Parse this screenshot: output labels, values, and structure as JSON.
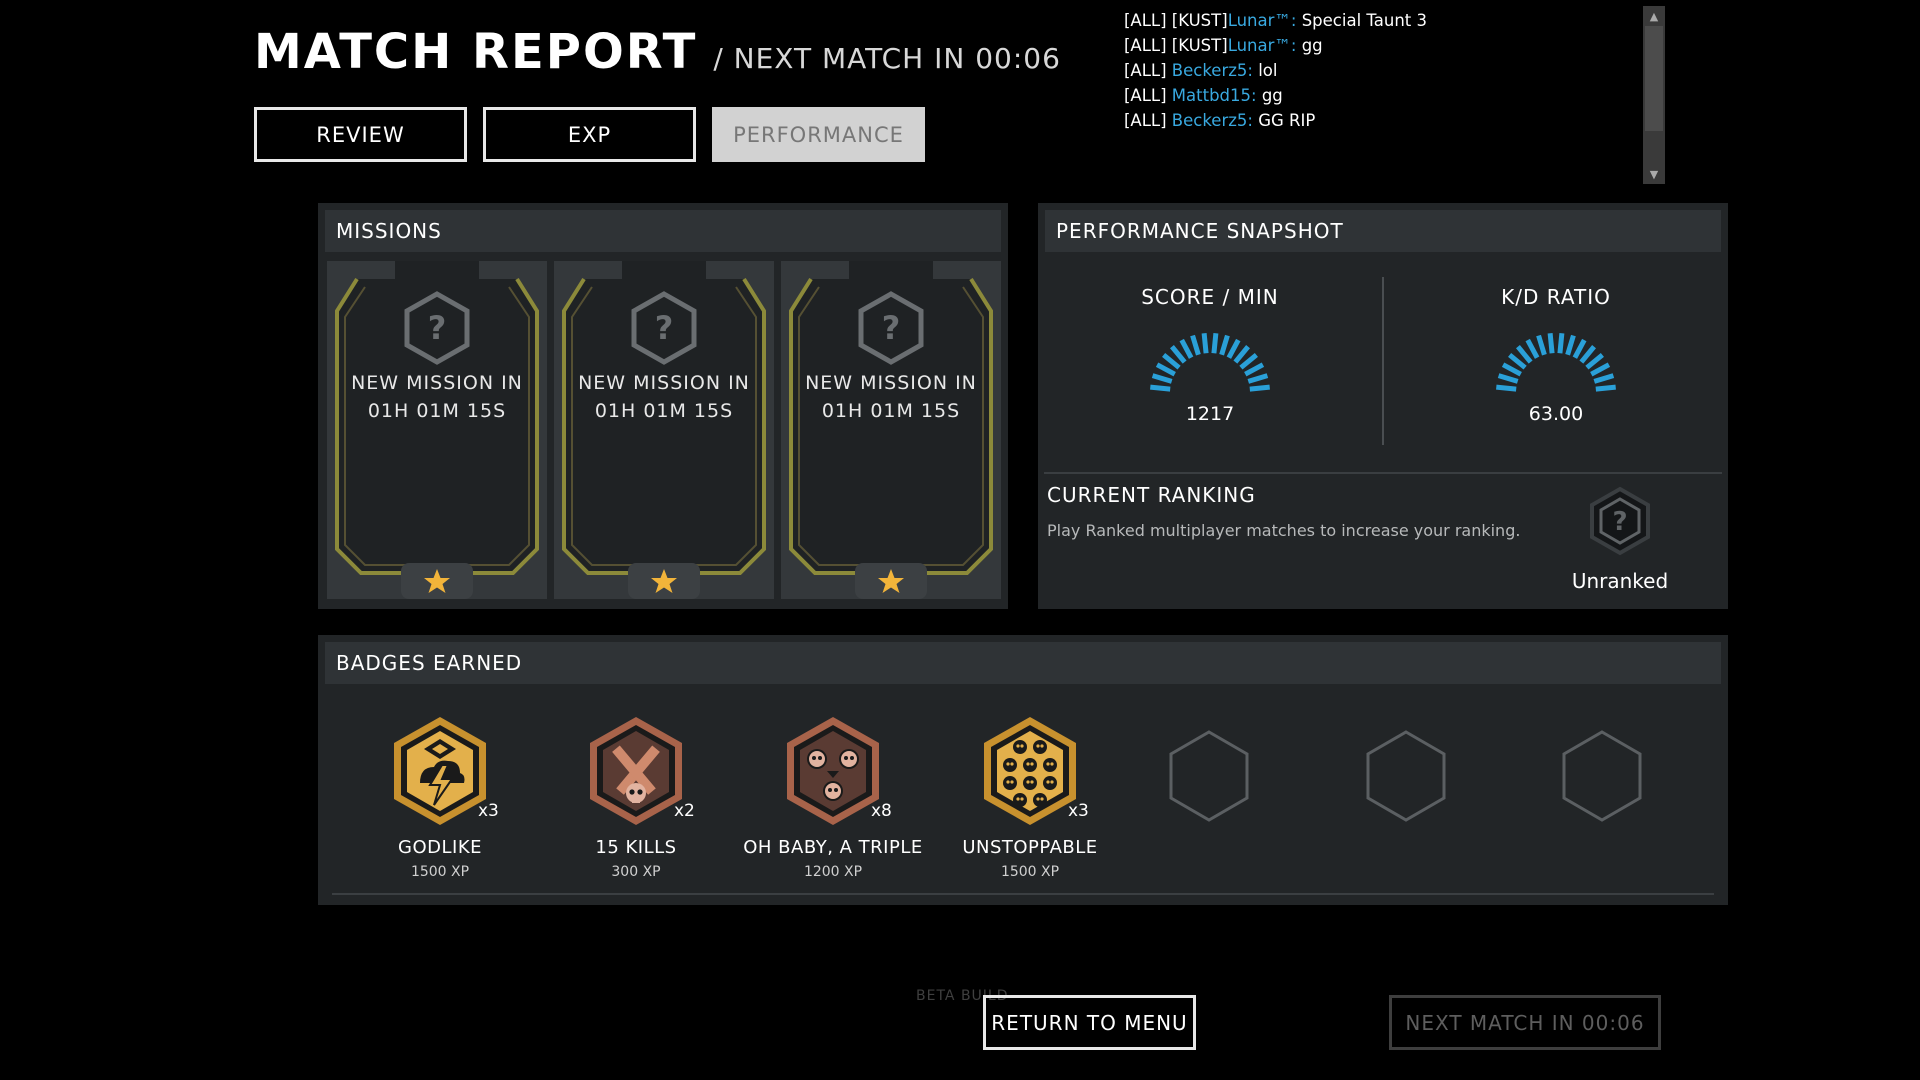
{
  "header": {
    "title": "MATCH REPORT",
    "subtitle": "/ NEXT MATCH IN 00:06"
  },
  "tabs": [
    {
      "label": "REVIEW",
      "active": false
    },
    {
      "label": "EXP",
      "active": false
    },
    {
      "label": "PERFORMANCE",
      "active": true
    }
  ],
  "chat": {
    "lines": [
      {
        "prefix": "[ALL] [KUST]",
        "name": "Lunar™:",
        "text": " Special Taunt 3"
      },
      {
        "prefix": "[ALL] [KUST]",
        "name": "Lunar™:",
        "text": " gg"
      },
      {
        "prefix": "[ALL] ",
        "name": "Beckerz5:",
        "text": " lol"
      },
      {
        "prefix": "[ALL] ",
        "name": "Mattbd15:",
        "text": " gg"
      },
      {
        "prefix": "[ALL] ",
        "name": "Beckerz5:",
        "text": " GG RIP"
      }
    ],
    "name_color": "#39a9e0"
  },
  "missions": {
    "title": "MISSIONS",
    "cards": [
      {
        "line1": "NEW MISSION IN",
        "line2": "01H 01M 15S",
        "icon": "question-hex-icon"
      },
      {
        "line1": "NEW MISSION IN",
        "line2": "01H 01M 15S",
        "icon": "question-hex-icon"
      },
      {
        "line1": "NEW MISSION IN",
        "line2": "01H 01M 15S",
        "icon": "question-hex-icon"
      }
    ],
    "frame_color": "#8c8a3a",
    "star_color": "#f2b43a"
  },
  "snapshot": {
    "title": "PERFORMANCE SNAPSHOT",
    "score": {
      "label": "SCORE / MIN",
      "value": "1217"
    },
    "kd": {
      "label": "K/D RATIO",
      "value": "63.00"
    },
    "gauge_color": "#2aa0d8",
    "ranking": {
      "title": "CURRENT RANKING",
      "description": "Play Ranked multiplayer matches to increase your ranking.",
      "label": "Unranked",
      "icon": "question-hex-icon"
    }
  },
  "badges": {
    "title": "BADGES EARNED",
    "items": [
      {
        "name": "GODLIKE",
        "xp": "1500 XP",
        "count": "x3",
        "icon": "lightning-badge-icon",
        "tier": "gold"
      },
      {
        "name": "15 KILLS",
        "xp": "300 XP",
        "count": "x2",
        "icon": "crossed-guns-skull-badge-icon",
        "tier": "bronze"
      },
      {
        "name": "OH BABY, A TRIPLE",
        "xp": "1200 XP",
        "count": "x8",
        "icon": "three-skulls-badge-icon",
        "tier": "bronze"
      },
      {
        "name": "UNSTOPPABLE",
        "xp": "1500 XP",
        "count": "x3",
        "icon": "many-skulls-badge-icon",
        "tier": "gold"
      }
    ],
    "empty_slots": 3
  },
  "footer": {
    "beta": "BETA BUILD",
    "return_label": "RETURN TO MENU",
    "next_label": "NEXT MATCH IN 00:06"
  }
}
